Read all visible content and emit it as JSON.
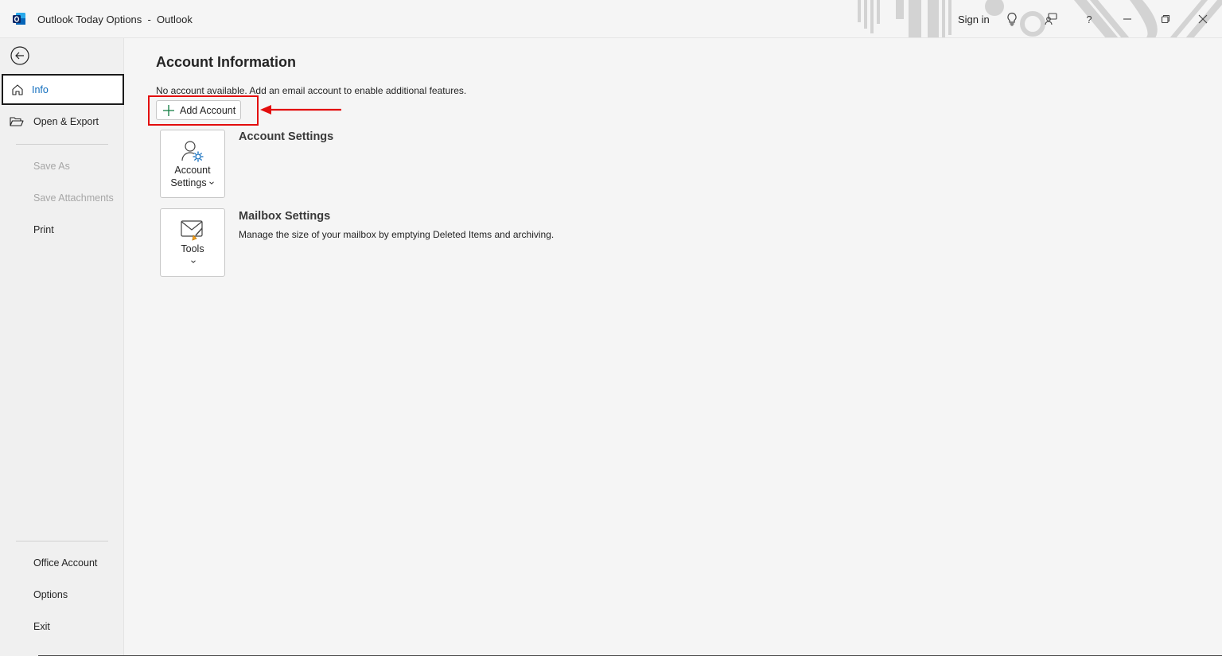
{
  "window": {
    "title": "Outlook Today Options  -  Outlook",
    "sign_in": "Sign in",
    "icons": [
      "outlook-logo-icon",
      "lightbulb-icon",
      "feedback-icon",
      "help-icon",
      "minimize-icon",
      "restore-icon",
      "close-icon"
    ],
    "help_glyph": "?"
  },
  "sidebar": {
    "items": [
      {
        "label": "Info",
        "active": true,
        "icon": "home-icon"
      },
      {
        "label": "Open & Export",
        "icon": "folder-open-icon"
      },
      {
        "label": "Save As",
        "disabled": true
      },
      {
        "label": "Save Attachments",
        "disabled": true
      },
      {
        "label": "Print"
      }
    ],
    "bottom_items": [
      {
        "label": "Office Account"
      },
      {
        "label": "Options"
      },
      {
        "label": "Exit"
      }
    ]
  },
  "main": {
    "title": "Account Information",
    "info_text": "No account available. Add an email account to enable additional features.",
    "add_account_label": "Add Account",
    "sections": [
      {
        "tile_line1": "Account",
        "tile_line2": "Settings",
        "title": "Account Settings",
        "description": "",
        "icon": "account-settings-icon"
      },
      {
        "tile_line1": "Tools",
        "title": "Mailbox Settings",
        "description": "Manage the size of your mailbox by emptying Deleted Items and archiving.",
        "icon": "mailbox-tools-icon"
      }
    ]
  },
  "colors": {
    "accent": "#0f6cbd",
    "highlight": "#e30d0d",
    "background": "#f5f5f5"
  }
}
